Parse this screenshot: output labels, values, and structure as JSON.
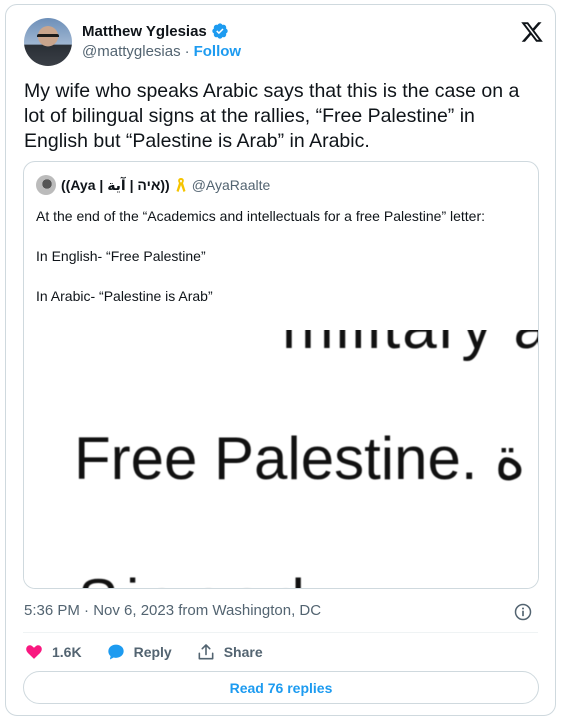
{
  "author": {
    "display_name": "Matthew Yglesias",
    "handle": "@mattyglesias",
    "separator": "·",
    "follow_label": "Follow",
    "verified": true
  },
  "tweet": {
    "text": "My wife who speaks Arabic says that this is the case on a lot of bilingual signs at the rallies, “Free Palestine” in English but “Palestine is Arab” in Arabic.",
    "timestamp": "5:36 PM · Nov 6, 2023 from Washington, DC"
  },
  "quoted": {
    "display_name": "((Aya | איה | آية))",
    "handle": "@AyaRaalte",
    "text": "At the end of the “Academics and intellectuals for a free Palestine” letter:\n\nIn English- “Free Palestine”\n\nIn Arabic- “Palestine is Arab”",
    "media": {
      "line1": "military a:",
      "line2": "Free Palestine. ة",
      "line3": "Signed"
    }
  },
  "actions": {
    "likes_count": "1.6K",
    "reply_label": "Reply",
    "share_label": "Share",
    "read_replies_label": "Read 76 replies"
  },
  "colors": {
    "brand_blue": "#1d9bf0",
    "like_pink": "#f91880",
    "secondary_text": "#536471",
    "border": "#cfd9de"
  },
  "icons": [
    "verified-badge-icon",
    "x-logo-icon",
    "yellow-ribbon-icon",
    "info-icon",
    "heart-icon",
    "reply-bubble-icon",
    "share-icon"
  ]
}
